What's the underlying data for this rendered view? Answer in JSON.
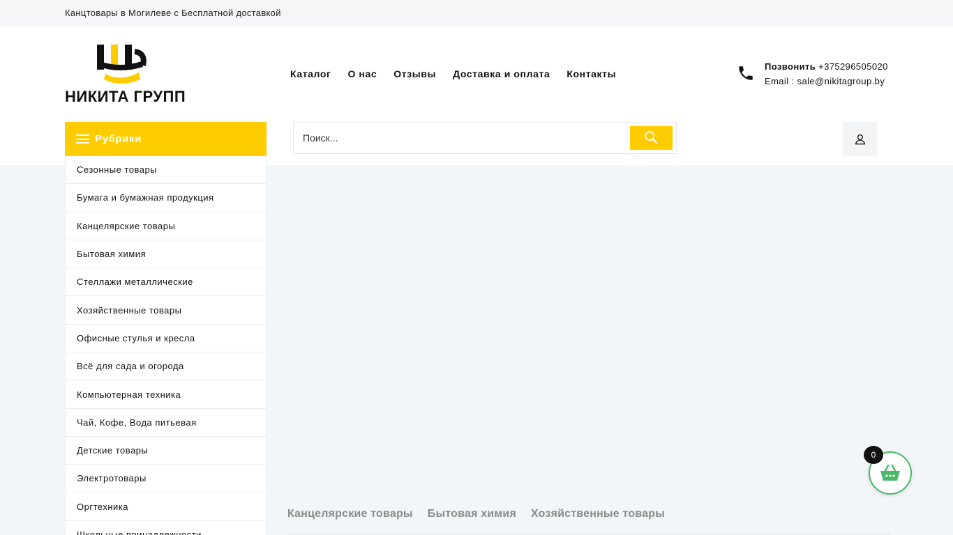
{
  "topbar": {
    "text": "Канцтовары в Могилеве с Бесплатной доставкой"
  },
  "brand": {
    "name": "НИКИТА ГРУПП",
    "accent_color": "#ffcc00"
  },
  "nav": {
    "items": [
      {
        "label": "Каталог"
      },
      {
        "label": "О нас"
      },
      {
        "label": "Отзывы"
      },
      {
        "label": "Доставка и оплата"
      },
      {
        "label": "Контакты"
      }
    ]
  },
  "contact": {
    "call_label": "Позвонить",
    "phone": "+375296505020",
    "email_label": "Email :",
    "email": "sale@nikitagroup.by",
    "icon": "phone-icon"
  },
  "rubriki": {
    "label": "Рубрики",
    "icon": "menu-icon"
  },
  "search": {
    "placeholder": "Поиск...",
    "value": "",
    "button_icon": "search-icon"
  },
  "account": {
    "icon": "user-icon"
  },
  "categories": [
    {
      "label": "Сезонные товары"
    },
    {
      "label": "Бумага и бумажная продукция"
    },
    {
      "label": "Канцелярские товары"
    },
    {
      "label": "Бытовая химия"
    },
    {
      "label": "Стеллажи металлические"
    },
    {
      "label": "Хозяйственные товары"
    },
    {
      "label": "Офисные стулья и кресла"
    },
    {
      "label": "Всё для сада и огорода"
    },
    {
      "label": "Компьютерная техника"
    },
    {
      "label": "Чай, Кофе, Вода питьевая"
    },
    {
      "label": "Детские товары"
    },
    {
      "label": "Электротовары"
    },
    {
      "label": "Оргтехника"
    },
    {
      "label": "Школьные принадлежности"
    }
  ],
  "product_tabs": [
    {
      "label": "Канцелярские товары"
    },
    {
      "label": "Бытовая химия"
    },
    {
      "label": "Хозяйственные товары"
    }
  ],
  "cart": {
    "count": "0",
    "icon": "basket-icon",
    "accent_color": "#4ab866"
  }
}
